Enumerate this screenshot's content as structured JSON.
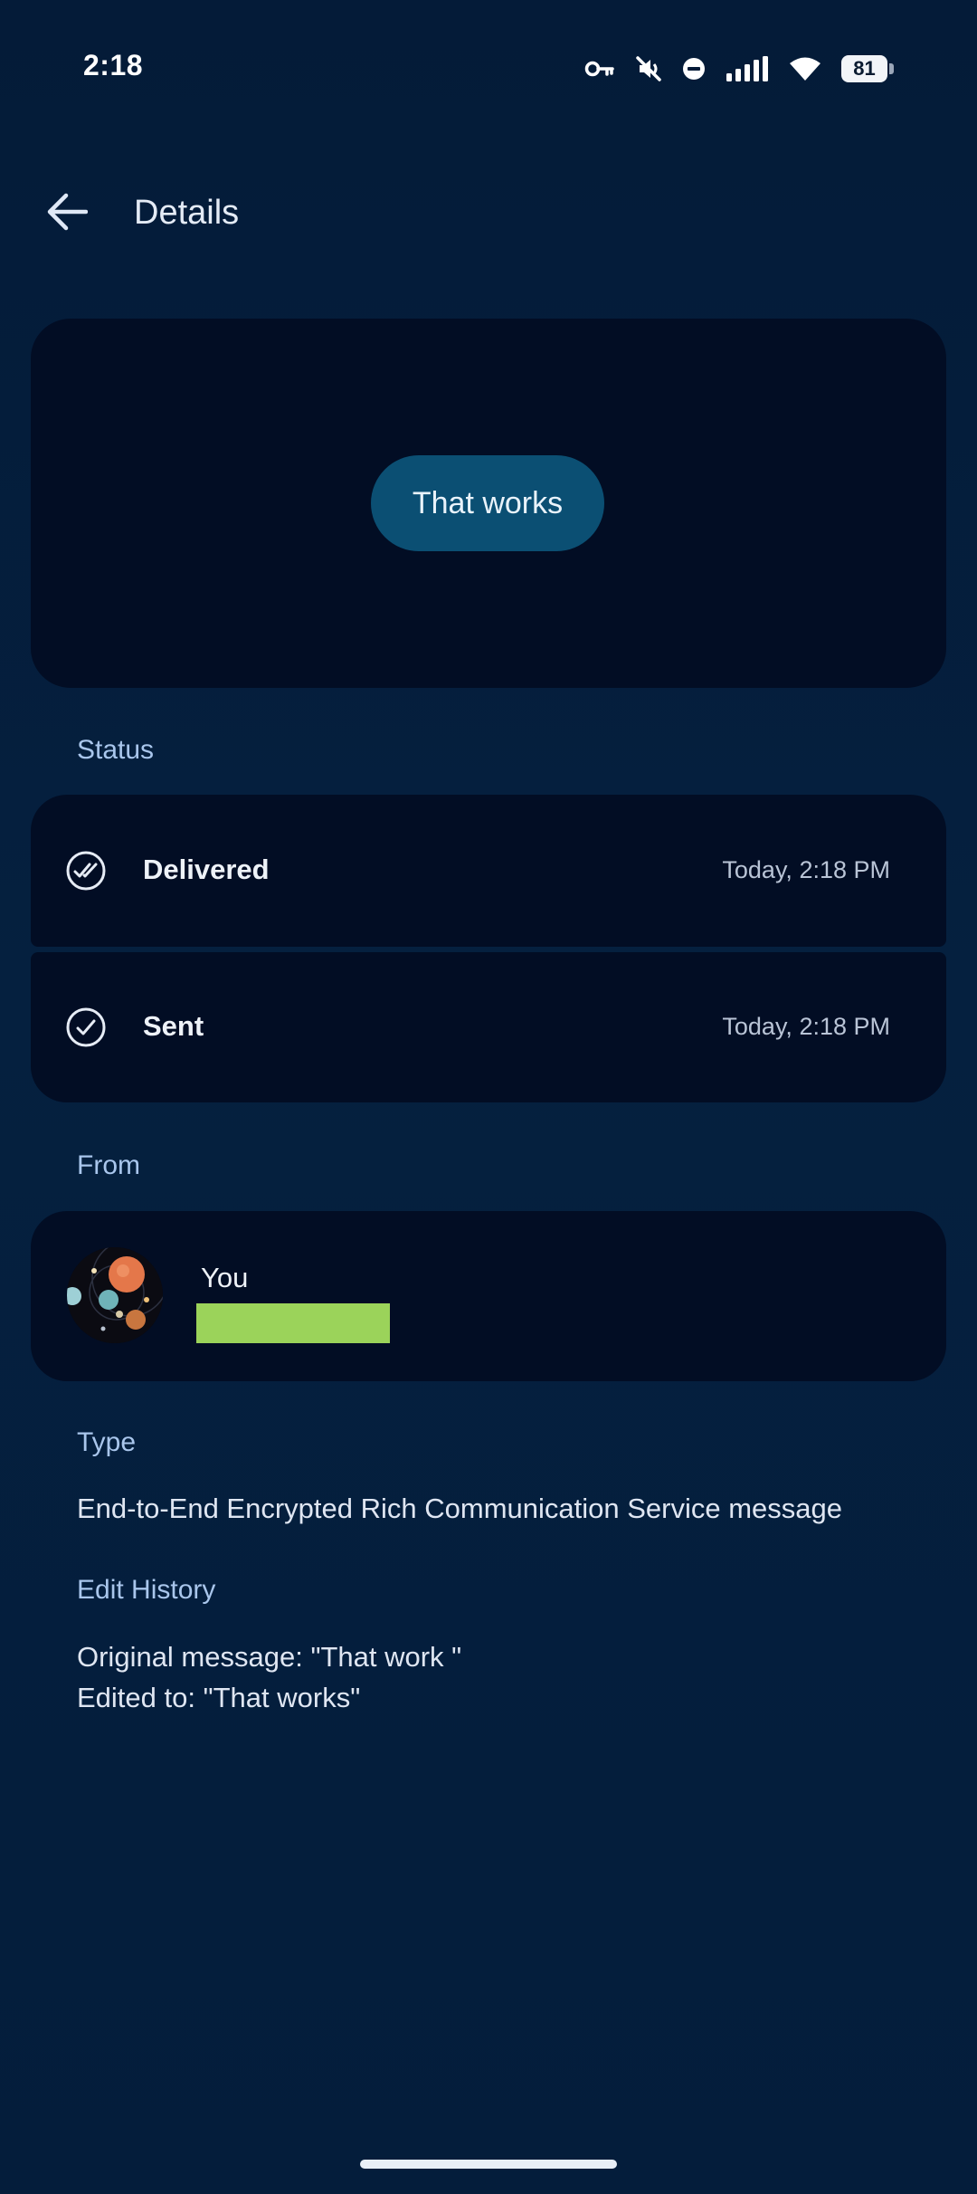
{
  "status_bar": {
    "time": "2:18",
    "battery": "81",
    "icons": [
      "vpn-key-icon",
      "mute-icon",
      "do-not-disturb-icon",
      "cellular-signal-icon",
      "wifi-icon",
      "battery-icon"
    ]
  },
  "app_bar": {
    "back_icon": "arrow-back-icon",
    "title": "Details"
  },
  "message_preview": {
    "text": "That works"
  },
  "status": {
    "label": "Status",
    "items": [
      {
        "name": "Delivered",
        "time": "Today, 2:18 PM",
        "icon": "double-check-icon"
      },
      {
        "name": "Sent",
        "time": "Today, 2:18 PM",
        "icon": "check-icon"
      }
    ]
  },
  "from": {
    "label": "From",
    "name": "You"
  },
  "type": {
    "label": "Type",
    "value": "End-to-End Encrypted Rich Communication Service message"
  },
  "edit_history": {
    "label": "Edit History",
    "original": "Original message: \"That work \"",
    "edited": "Edited to: \"That works\""
  },
  "colors": {
    "background": "#041b38",
    "card": "#020d24",
    "bubble": "#0b4f73",
    "section_label": "#a9c6ec",
    "redaction": "#9bd35a"
  }
}
